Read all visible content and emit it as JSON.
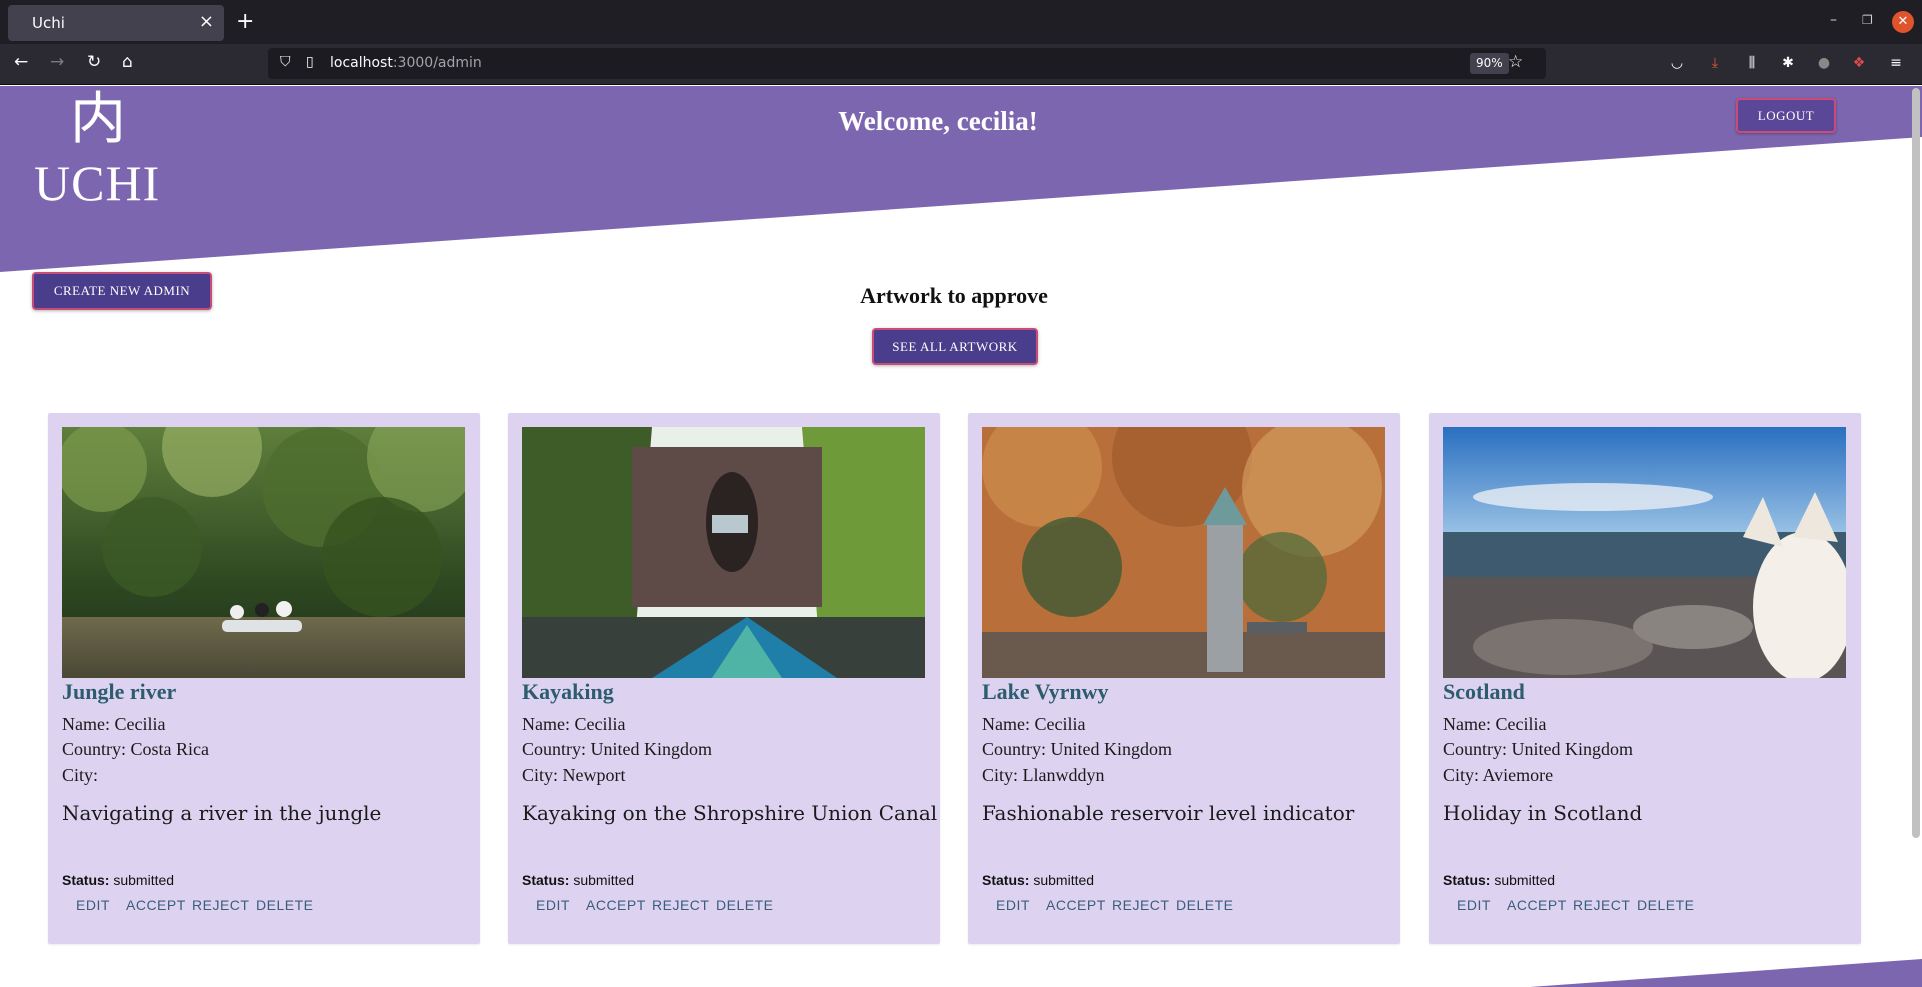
{
  "browser": {
    "tab_title": "Uchi",
    "tab_close": "×",
    "new_tab": "+",
    "url_host": "localhost",
    "url_path": ":3000/admin",
    "zoom": "90%",
    "icons": [
      "back-icon",
      "forward-icon",
      "reload-icon",
      "home-icon",
      "shield-icon",
      "page-icon",
      "star-icon",
      "pocket-icon",
      "download-icon",
      "library-icon",
      "extension-icon",
      "account-icon",
      "menu-icon"
    ]
  },
  "header": {
    "logo_kanji": "内",
    "logo_word": "UCHI",
    "welcome": "Welcome, cecilia!",
    "logout_label": "Logout",
    "brand_color": "#7d66b0"
  },
  "main": {
    "create_admin_label": "Create new admin",
    "section_title": "Artwork to approve",
    "see_all_label": "See all artwork",
    "status_label": "Status:",
    "actions": {
      "edit": "EDIT",
      "accept": "ACCEPT",
      "reject": "REJECT",
      "delete": "DELETE"
    }
  },
  "cards": [
    {
      "title": "Jungle river",
      "name": "Name: Cecilia",
      "country": "Country: Costa Rica",
      "city": "City:",
      "description": "Navigating a river in the jungle",
      "status": "submitted",
      "image": "jungle-river-photo"
    },
    {
      "title": "Kayaking",
      "name": "Name: Cecilia",
      "country": "Country: United Kingdom",
      "city": "City: Newport",
      "description": "Kayaking on the Shropshire Union Canal",
      "status": "submitted",
      "image": "kayaking-photo"
    },
    {
      "title": "Lake Vyrnwy",
      "name": "Name: Cecilia",
      "country": "Country: United Kingdom",
      "city": "City: Llanwddyn",
      "description": "Fashionable reservoir level indicator",
      "status": "submitted",
      "image": "lake-vyrnwy-photo"
    },
    {
      "title": "Scotland",
      "name": "Name: Cecilia",
      "country": "Country: United Kingdom",
      "city": "City: Aviemore",
      "description": "Holiday in Scotland",
      "status": "submitted",
      "image": "scotland-photo"
    }
  ]
}
